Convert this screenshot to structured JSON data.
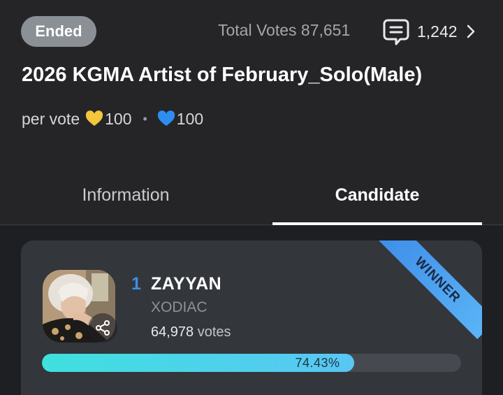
{
  "header": {
    "status": "Ended",
    "total_votes_label": "Total Votes",
    "total_votes_value": "87,651",
    "comment_count": "1,242"
  },
  "title": "2026 KGMA Artist of February_Solo(Male)",
  "per_vote": {
    "label": "per vote",
    "gold_value": "100",
    "separator": "•",
    "blue_value": "100"
  },
  "tabs": [
    {
      "label": "Information",
      "active": false
    },
    {
      "label": "Candidate",
      "active": true
    }
  ],
  "candidate": {
    "badge": "WINNER",
    "rank": "1",
    "name": "ZAYYAN",
    "group": "XODIAC",
    "votes_value": "64,978",
    "votes_unit": "votes",
    "percent_label": "74.43%",
    "percent": 74.43
  },
  "colors": {
    "background": "#252528",
    "accent_blue": "#3f8ee8",
    "gold_heart": "#f5c63a",
    "blue_heart": "#2e8ef0",
    "bar_start": "#3fe0de",
    "bar_end": "#59c6f4"
  },
  "icons": {
    "comment": "comment-bubble-icon",
    "chevron": "chevron-right-icon",
    "gold_heart": "gold-heart-icon",
    "blue_heart": "blue-heart-icon",
    "share": "share-icon"
  }
}
